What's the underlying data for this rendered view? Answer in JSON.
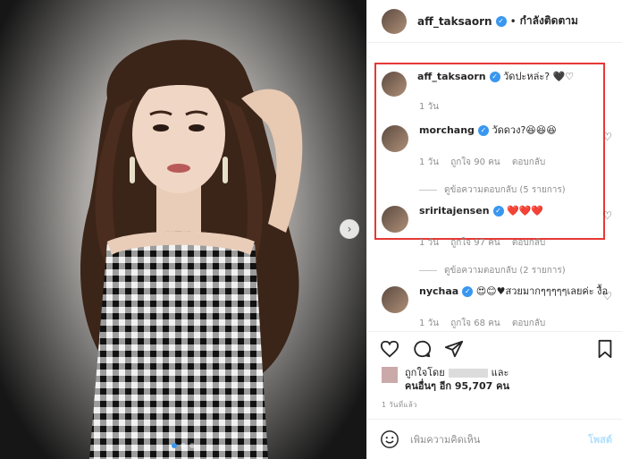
{
  "post": {
    "author": "aff_taksaorn",
    "follow_label": "กำลังติดตาม",
    "dot": "•",
    "next_icon": "chevron-right-icon",
    "carousel_dots": 3
  },
  "comments": [
    {
      "user": "aff_taksaorn",
      "verified": true,
      "text": "วัดปะหล่ะ? 🖤♡",
      "time": "1 วัน"
    },
    {
      "user": "morchang",
      "verified": true,
      "text": "วัดดวง?😆😆😆",
      "time": "1 วัน",
      "likes": "ถูกใจ 90 คน",
      "reply": "ตอบกลับ",
      "view_replies": "ดูข้อความตอบกลับ (5 รายการ)"
    },
    {
      "user": "sriritajensen",
      "verified": true,
      "text": "❤️❤️❤️",
      "time": "1 วัน",
      "likes": "ถูกใจ 97 คน",
      "reply": "ตอบกลับ",
      "view_replies": "ดูข้อความตอบกลับ (2 รายการ)"
    },
    {
      "user": "nychaa",
      "verified": true,
      "text": "😍😊♥สวยมากๆๆๆๆๆเลยค่ะ งื้อ",
      "time": "1 วัน",
      "likes": "ถูกใจ 68 คน",
      "reply": "ตอบกลับ"
    }
  ],
  "actions": {
    "liked_by_prefix": "ถูกใจโดย",
    "liked_by_and": "และ",
    "others": "คนอื่นๆ อีก 95,707 คน",
    "time_ago": "1 วันที่แล้ว"
  },
  "composer": {
    "placeholder": "เพิ่มความคิดเห็น",
    "post_label": "โพสต์"
  },
  "colors": {
    "accent": "#3897f0",
    "highlight_border": "#e53935",
    "post_button_disabled": "#b2dffc"
  }
}
